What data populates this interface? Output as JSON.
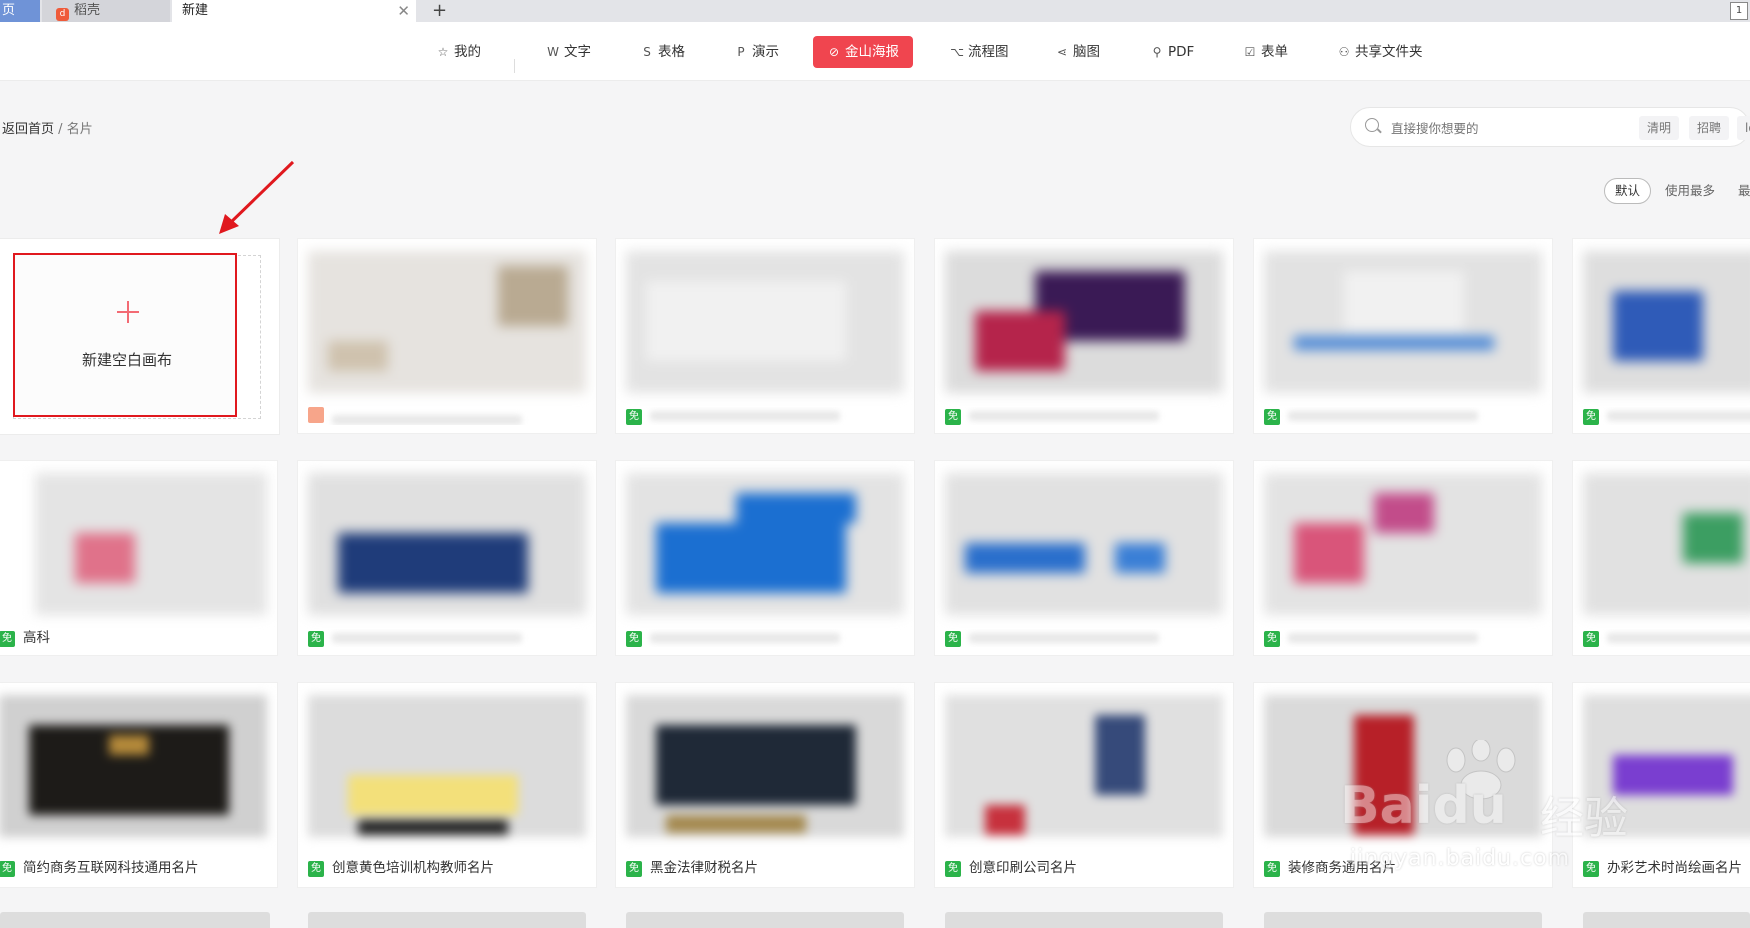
{
  "tabs": {
    "home_label": "页",
    "daoke_label": "稻壳",
    "active_label": "新建",
    "close_glyph": "✕",
    "new_tab_glyph": "+",
    "window_badge": "1"
  },
  "nav": {
    "items": [
      {
        "label": "我的",
        "icon": "star-icon"
      },
      {
        "label": "文字",
        "icon": "w-icon"
      },
      {
        "label": "表格",
        "icon": "s-icon"
      },
      {
        "label": "演示",
        "icon": "p-icon"
      },
      {
        "label": "金山海报",
        "icon": "poster-icon"
      },
      {
        "label": "流程图",
        "icon": "flowchart-icon"
      },
      {
        "label": "脑图",
        "icon": "mindmap-icon"
      },
      {
        "label": "PDF",
        "icon": "pdf-icon"
      },
      {
        "label": "表单",
        "icon": "form-icon"
      },
      {
        "label": "共享文件夹",
        "icon": "share-folder-icon"
      }
    ],
    "active_color": "#f0454f"
  },
  "breadcrumb": {
    "back": "返回首页",
    "sep": "/",
    "current": "名片"
  },
  "search": {
    "placeholder": "直接搜你想要的",
    "tags": [
      "清明",
      "招聘",
      "lo"
    ]
  },
  "sort": {
    "options": [
      "默认",
      "使用最多",
      "最"
    ]
  },
  "new_canvas": {
    "label": "新建空白画布"
  },
  "templates": {
    "free_badge": "免",
    "row2_first_title": "高科",
    "row3": [
      {
        "title": "简约商务互联网科技通用名片"
      },
      {
        "title": "创意黄色培训机构教师名片"
      },
      {
        "title": "黑金法律财税名片"
      },
      {
        "title": "创意印刷公司名片"
      },
      {
        "title": "装修商务通用名片"
      },
      {
        "title": "办彩艺术时尚绘画名片"
      }
    ]
  },
  "watermark": {
    "brand": "Bai",
    "brand2": "du",
    "product": "经验",
    "url": "jingyan.baidu.com"
  },
  "colors": {
    "highlight_box": "#e0181e",
    "free_badge": "#2bb34a",
    "arrow": "#e0181e"
  }
}
